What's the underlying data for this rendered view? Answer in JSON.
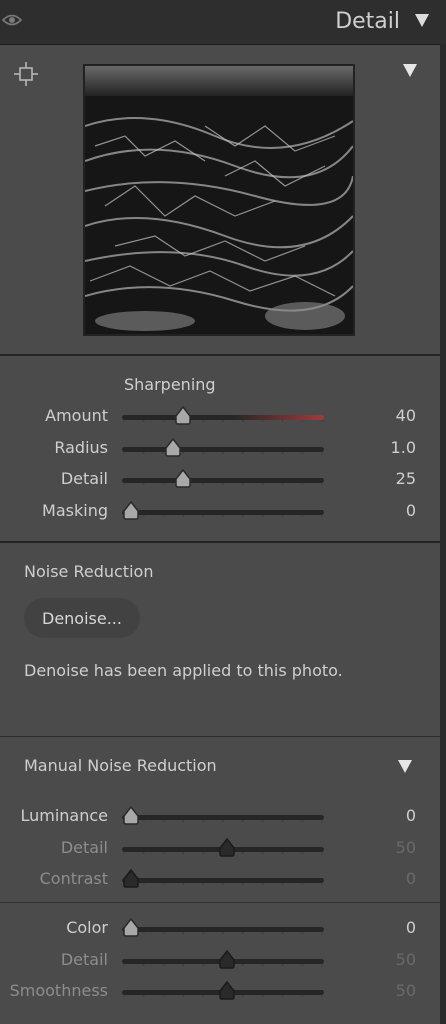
{
  "header": {
    "title": "Detail"
  },
  "sharpening": {
    "title": "Sharpening",
    "rows": [
      {
        "label": "Amount",
        "value": "40",
        "fraction": 0.27,
        "dim": false,
        "redline": true
      },
      {
        "label": "Radius",
        "value": "1.0",
        "fraction": 0.22,
        "dim": false,
        "redline": false
      },
      {
        "label": "Detail",
        "value": "25",
        "fraction": 0.27,
        "dim": false,
        "redline": false
      },
      {
        "label": "Masking",
        "value": "0",
        "fraction": 0.0,
        "dim": false,
        "redline": false
      }
    ]
  },
  "noise_reduction": {
    "title": "Noise Reduction",
    "button_label": "Denoise...",
    "info": "Denoise has been applied to this photo."
  },
  "manual_noise": {
    "title": "Manual Noise Reduction",
    "luminance_rows": [
      {
        "label": "Luminance",
        "value": "0",
        "fraction": 0.0,
        "dim": false
      },
      {
        "label": "Detail",
        "value": "50",
        "fraction": 0.5,
        "dim": true
      },
      {
        "label": "Contrast",
        "value": "0",
        "fraction": 0.0,
        "dim": true
      }
    ],
    "color_rows": [
      {
        "label": "Color",
        "value": "0",
        "fraction": 0.0,
        "dim": false
      },
      {
        "label": "Detail",
        "value": "50",
        "fraction": 0.5,
        "dim": true
      },
      {
        "label": "Smoothness",
        "value": "50",
        "fraction": 0.5,
        "dim": true
      }
    ]
  },
  "colors": {
    "panel_bg": "#4b4b4b",
    "header_bg": "#2e2e2e",
    "accent_red": "#a03b3b"
  }
}
